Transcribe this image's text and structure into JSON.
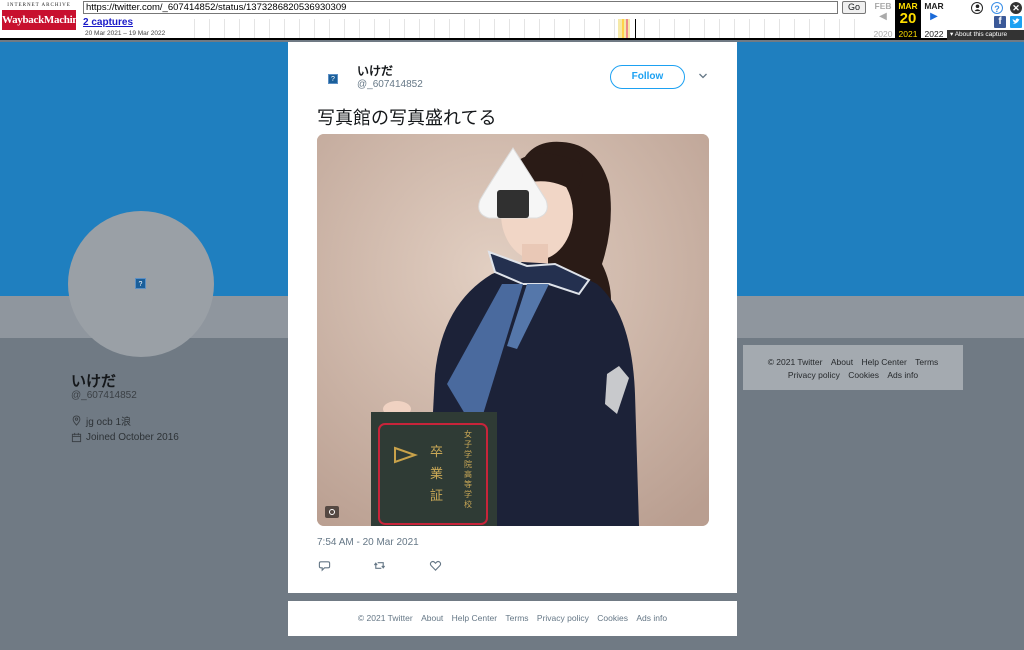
{
  "wayback": {
    "logo_top": "INTERNET ARCHIVE",
    "logo_main": "WaybackMachine",
    "url": "https://twitter.com/_607414852/status/1373286820536930309",
    "go_label": "Go",
    "captures": "2 captures",
    "range": "20 Mar 2021 – 19 Mar 2022",
    "prev": {
      "month": "FEB",
      "year": "2020"
    },
    "current": {
      "month": "MAR",
      "day": "20",
      "year": "2021"
    },
    "next": {
      "month": "MAR",
      "year": "2022"
    },
    "about": "About this capture"
  },
  "profile": {
    "name": "いけだ",
    "handle": "@_607414852",
    "location": "jg ocb 1浪",
    "joined": "Joined October 2016"
  },
  "tweet": {
    "name": "いけだ",
    "handle": "@_607414852",
    "follow_label": "Follow",
    "text": "写真館の写真盛れてる",
    "timestamp": "7:54 AM - 20 Mar 2021",
    "certificate_school": "女子学院高等学校",
    "certificate_title": "卒業証"
  },
  "footer": {
    "links": [
      "© 2021 Twitter",
      "About",
      "Help Center",
      "Terms",
      "Privacy policy",
      "Cookies",
      "Ads info"
    ]
  },
  "colors": {
    "twitter_blue": "#1da1f2",
    "banner": "#1f7fbf",
    "wayback_red": "#c8102e"
  }
}
